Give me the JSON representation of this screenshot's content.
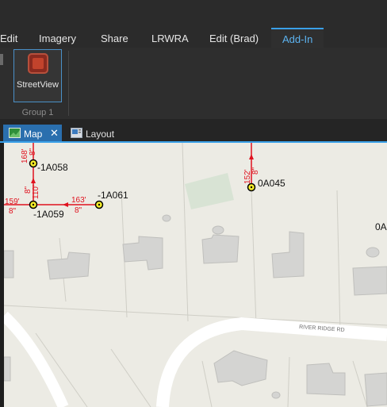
{
  "ribbon": {
    "tabs": [
      {
        "label": "Edit",
        "active": false
      },
      {
        "label": "Imagery",
        "active": false
      },
      {
        "label": "Share",
        "active": false
      },
      {
        "label": "LRWRA",
        "active": false
      },
      {
        "label": "Edit (Brad)",
        "active": false
      },
      {
        "label": "Add-In",
        "active": true
      }
    ],
    "streetview_button": {
      "label": "StreetView",
      "icon": "streetview-icon"
    },
    "group_label": "Group 1"
  },
  "document_tabs": [
    {
      "label": "Map",
      "active": true,
      "icon": "map-icon",
      "close": "✕"
    },
    {
      "label": "Layout",
      "active": false,
      "icon": "layout-icon"
    }
  ],
  "map": {
    "road_label": "RIVER RIDGE RD",
    "manholes": [
      {
        "id": "-1A058"
      },
      {
        "id": "-1A059"
      },
      {
        "id": "-1A061"
      },
      {
        "id": "0A045"
      },
      {
        "id": "0A"
      }
    ],
    "pipe_labels": {
      "p1_len": "168'",
      "p1_dia": "8\"",
      "p2_len": "110'",
      "p2_dia": "8\"",
      "p3_len": "159'",
      "p3_dia": "8\"",
      "p4_len": "163'",
      "p4_dia": "8\"",
      "p5_len": "152'",
      "p5_dia": "8\""
    },
    "colors": {
      "pipe": "#e0121f",
      "manhole": "#f6ee2a",
      "background": "#ecebe4",
      "building": "#d4d4d2",
      "road": "#ffffff"
    }
  }
}
